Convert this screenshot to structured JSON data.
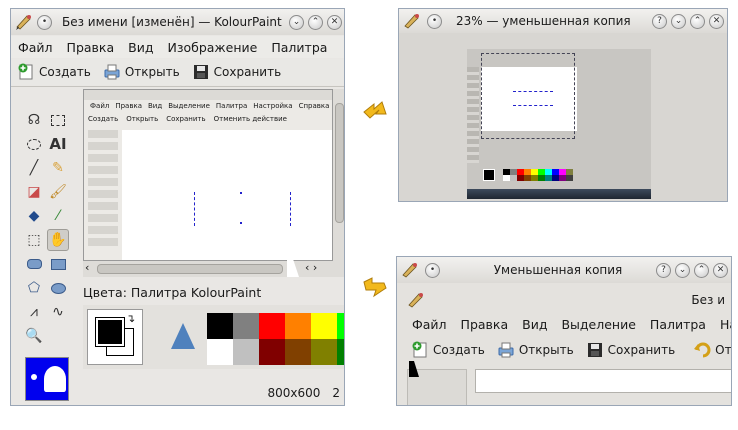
{
  "main_window": {
    "title": "Без имени [изменён] — KolourPaint",
    "menu": [
      "Файл",
      "Правка",
      "Вид",
      "Изображение",
      "Палитра"
    ],
    "toolbar": {
      "new": "Создать",
      "open": "Открыть",
      "save": "Сохранить"
    },
    "inner_menu": [
      "Файл",
      "Правка",
      "Вид",
      "Выделение",
      "Палитра",
      "Настройка",
      "Справка"
    ],
    "inner_toolbar": {
      "new": "Создать",
      "open": "Открыть",
      "save": "Сохранить",
      "undo": "Отменить действие"
    },
    "palette_label": "Цвета: Палитра KolourPaint",
    "status_size": "800x600",
    "status_extra": "2",
    "tool_text_label": "AI"
  },
  "top_right_window": {
    "title": "23% — уменьшенная копия"
  },
  "bottom_right_window": {
    "title": "Уменьшенная копия",
    "doc_title_partial": "Без и",
    "menu": [
      "Файл",
      "Правка",
      "Вид",
      "Выделение",
      "Палитра",
      "Наст"
    ],
    "toolbar": {
      "new": "Создать",
      "open": "Открыть",
      "save": "Сохранить",
      "undo_partial": "Отм"
    }
  },
  "palette_colors": {
    "top": [
      "#000000",
      "#808080",
      "#ff0000",
      "#ff8000",
      "#ffff00",
      "#00ff00"
    ],
    "bottom": [
      "#ffffff",
      "#c0c0c0",
      "#800000",
      "#804000",
      "#808000",
      "#008000"
    ]
  }
}
